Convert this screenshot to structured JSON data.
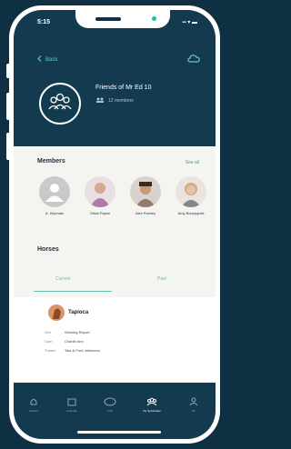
{
  "status": {
    "time": "5:15",
    "icons": "▪▪ ▾ ▬"
  },
  "header": {
    "back_label": "Back",
    "group_name": "Friends of Mr Ed 10",
    "member_count": "12 members"
  },
  "members": {
    "title": "Members",
    "see_all": "See all",
    "items": [
      {
        "name": "A. Kilpmatz",
        "color": "#c9c9c9"
      },
      {
        "name": "Olivia Payne",
        "color": "#b07aa8"
      },
      {
        "name": "Alex Rowley",
        "color": "#8e7b6a"
      },
      {
        "name": "Amy Bonnyquist",
        "color": "#d9a87a"
      }
    ]
  },
  "horses": {
    "title": "Horses",
    "tabs": [
      {
        "label": "Current"
      },
      {
        "label": "Past"
      }
    ],
    "card": {
      "name": "Tapioca",
      "rows": [
        {
          "label": "Sire",
          "value": "Winning Report"
        },
        {
          "label": "Dam",
          "value": "Charlie Ann"
        },
        {
          "label": "Trainer",
          "value": "Tala & Fred Johnsons"
        }
      ]
    }
  },
  "nav": {
    "items": [
      {
        "label": "Notices"
      },
      {
        "label": "Calendar"
      },
      {
        "label": "Chat"
      },
      {
        "label": "My Syndicates"
      },
      {
        "label": "Me"
      }
    ]
  },
  "colors": {
    "accent": "#5fbfb3",
    "header": "#143a50",
    "background": "#0f2f43"
  }
}
